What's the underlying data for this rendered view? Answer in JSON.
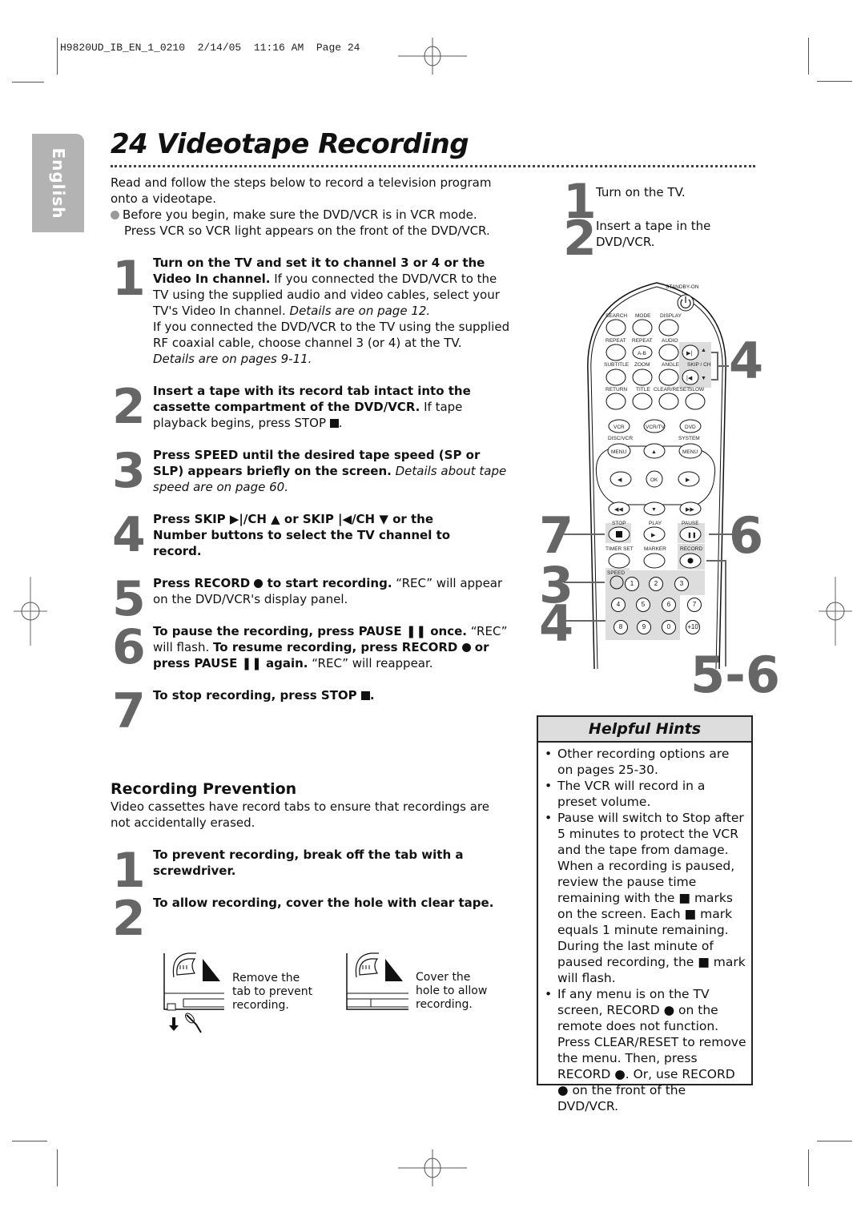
{
  "slug": "H9820UD_IB_EN_1_0210  2/14/05  11:16 AM  Page 24",
  "language_tab": "English",
  "page_title": "24  Videotape Recording",
  "intro": {
    "text": "Read and follow the steps below to record a television program onto a videotape.",
    "bullet_line1": "Before you begin, make sure the DVD/VCR is in VCR mode.",
    "bullet_line2": "Press VCR so VCR light appears on the front of the DVD/VCR."
  },
  "steps": [
    {
      "num": "1",
      "bold": "Turn on the TV and set it to channel 3 or 4 or the Video In channel.",
      "text": " If you connected the DVD/VCR to the TV using the supplied audio and video cables, select your TV's Video In channel. ",
      "italic": "Details are on page 12.",
      "text2": "If you connected the DVD/VCR to the TV using the supplied RF coaxial cable, choose channel 3 (or 4) at the TV.",
      "italic2": "Details are on pages 9-11."
    },
    {
      "num": "2",
      "bold": "Insert a tape with its record tab intact into the cassette compartment of the DVD/VCR.",
      "text": " If tape playback begins, press STOP "
    },
    {
      "num": "3",
      "bold": "Press SPEED until the desired tape speed (SP or SLP) appears briefly on the screen.",
      "italic": " Details about tape speed are on page 60."
    },
    {
      "num": "4",
      "bold_a": "Press SKIP ▶|/CH ▲ or SKIP |◀/CH ▼ or the Number buttons to select the TV channel to record."
    },
    {
      "num": "5",
      "bold_a": "Press RECORD ",
      "bold_b": " to start recording.",
      "text": " “REC” will appear on the DVD/VCR's display panel."
    },
    {
      "num": "6",
      "bold_a": "To pause the recording, press PAUSE ❚❚ once.",
      "text_a": " “REC” will flash. ",
      "bold_b": "To resume recording, press RECORD ",
      "bold_c": " or press PAUSE ❚❚ again.",
      "text_b": " “REC” will reappear."
    },
    {
      "num": "7",
      "bold_a": "To stop recording, press STOP "
    }
  ],
  "prevention": {
    "heading": "Recording Prevention",
    "text": "Video cassettes have record tabs to ensure that recordings are not accidentally erased.",
    "steps": [
      {
        "num": "1",
        "bold": "To prevent recording, break off the tab with a screwdriver."
      },
      {
        "num": "2",
        "bold": "To allow recording, cover the hole with clear tape."
      }
    ],
    "captions": [
      {
        "line1": "Remove the",
        "line2": "tab to prevent",
        "line3": "recording."
      },
      {
        "line1": "Cover the",
        "line2": "hole to allow",
        "line3": "recording."
      }
    ]
  },
  "right_steps": [
    {
      "num": "1",
      "text": "Turn on the TV."
    },
    {
      "num": "2",
      "line1": "Insert a tape in the",
      "line2": "DVD/VCR."
    }
  ],
  "remote": {
    "standby": "STANDBY-ON",
    "row1": [
      "SEARCH",
      "MODE",
      "DISPLAY"
    ],
    "row2": [
      "REPEAT",
      "REPEAT",
      "AUDIO"
    ],
    "ab": "A-B",
    "row3": [
      "SUBTITLE",
      "ZOOM",
      "ANGLE",
      "SKIP / CH"
    ],
    "row4": [
      "RETURN",
      "TITLE",
      "CLEAR/RESET",
      "SLOW"
    ],
    "mode_buttons": [
      "VCR",
      "VCR/TV",
      "DVD"
    ],
    "disc_vcr": "DISC/VCR",
    "system": "SYSTEM",
    "menu": "MENU",
    "ok": "OK",
    "transport_labels": [
      "STOP",
      "PLAY",
      "PAUSE"
    ],
    "row_timer": [
      "TIMER SET",
      "MARKER",
      "RECORD"
    ],
    "speed": "SPEED",
    "numbers": [
      "1",
      "2",
      "3",
      "4",
      "5",
      "6",
      "7",
      "8",
      "9",
      "0",
      "+10"
    ]
  },
  "callouts": {
    "skip": "4",
    "stop": "7",
    "pause": "6",
    "speed": "3",
    "numbers": "4",
    "record": "5-6"
  },
  "hints": {
    "title": "Helpful Hints",
    "items": [
      "Other recording options are on pages 25-30.",
      "The VCR will record in a preset volume.",
      "Pause will switch to Stop after 5 minutes to protect the VCR and the tape from damage. When a recording is paused, review the pause time remaining with the ■ marks on the screen. Each ■ mark equals 1 minute remaining. During the last minute of paused recording, the ■ mark will flash.",
      "If any menu is on the TV screen, RECORD ● on the remote does not function. Press CLEAR/RESET to remove the menu. Then, press RECORD ●. Or, use RECORD ● on the front of the DVD/VCR."
    ]
  },
  "colors": {
    "accent_gray": "#666666",
    "tab_gray": "#b3b3b3",
    "hint_header": "#dddddd"
  }
}
